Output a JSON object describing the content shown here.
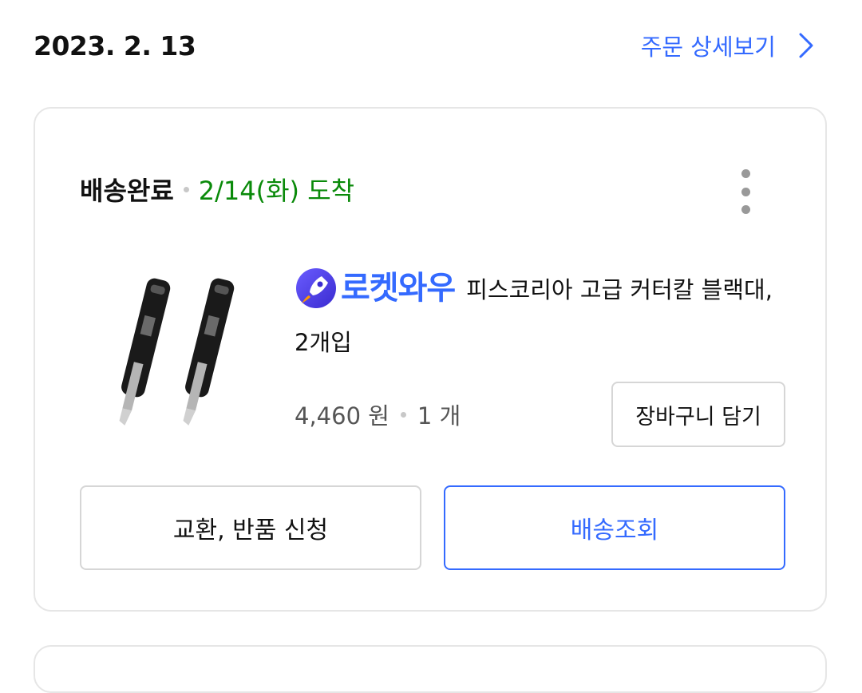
{
  "order": {
    "date": "2023. 2. 13",
    "detail_link_label": "주문 상세보기"
  },
  "delivery": {
    "status": "배송완료",
    "arrival": "2/14(화) 도착"
  },
  "product": {
    "badge_text": "로켓와우",
    "title": "피스코리아 고급 커터칼 블랙대, 2개입",
    "price": "4,460 원",
    "quantity": "1 개",
    "image_icon": "utility-knife-pair-image"
  },
  "buttons": {
    "add_to_cart": "장바구니 담기",
    "exchange_return": "교환, 반품 신청",
    "track_delivery": "배송조회"
  },
  "colors": {
    "accent_blue": "#346aff",
    "delivered_green": "#0a8a0a",
    "border_gray": "#e6e6e6"
  }
}
